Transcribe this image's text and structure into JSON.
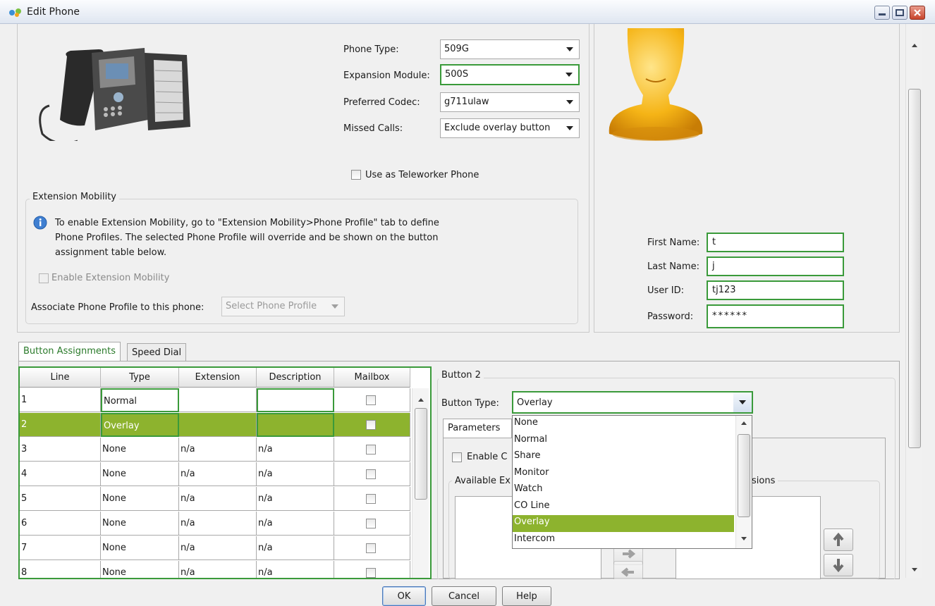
{
  "window": {
    "title": "Edit Phone"
  },
  "phone": {
    "type_label": "Phone Type:",
    "type_value": "509G",
    "module_label": "Expansion Module:",
    "module_value": "500S",
    "codec_label": "Preferred Codec:",
    "codec_value": "g711ulaw",
    "missed_label": "Missed Calls:",
    "missed_value": "Exclude overlay button",
    "teleworker_label": "Use as Teleworker Phone"
  },
  "mobility": {
    "group_label": "Extension Mobility",
    "info_text_1": "To enable Extension Mobility, go to \"Extension Mobility>Phone Profile\" tab to define",
    "info_text_2": "Phone Profiles. The selected Phone Profile will override and be shown on the button",
    "info_text_3": "assignment table below.",
    "enable_label": "Enable Extension Mobility",
    "associate_label": "Associate Phone Profile to this phone:",
    "profile_placeholder": "Select Phone Profile"
  },
  "user": {
    "first_label": "First Name:",
    "first_value": "t",
    "last_label": "Last Name:",
    "last_value": "j",
    "id_label": "User ID:",
    "id_value": "tj123",
    "password_label": "Password:",
    "password_value": "******"
  },
  "tabs": [
    {
      "label": "Button Assignments"
    },
    {
      "label": "Speed Dial"
    }
  ],
  "table": {
    "headers": [
      "Line",
      "Type",
      "Extension",
      "Description",
      "Mailbox"
    ],
    "rows": [
      {
        "line": "1",
        "type": "Normal",
        "extension": "",
        "description": ""
      },
      {
        "line": "2",
        "type": "Overlay",
        "extension": "",
        "description": ""
      },
      {
        "line": "3",
        "type": "None",
        "extension": "n/a",
        "description": "n/a"
      },
      {
        "line": "4",
        "type": "None",
        "extension": "n/a",
        "description": "n/a"
      },
      {
        "line": "5",
        "type": "None",
        "extension": "n/a",
        "description": "n/a"
      },
      {
        "line": "6",
        "type": "None",
        "extension": "n/a",
        "description": "n/a"
      },
      {
        "line": "7",
        "type": "None",
        "extension": "n/a",
        "description": "n/a"
      },
      {
        "line": "8",
        "type": "None",
        "extension": "n/a",
        "description": "n/a"
      }
    ]
  },
  "button_panel": {
    "group_label": "Button 2",
    "type_label": "Button Type:",
    "type_value": "Overlay",
    "params_tab": "Parameters",
    "enable_partial": "Enable C",
    "available_partial": "Available Ex",
    "sions_partial": "sions"
  },
  "dropdown": {
    "options": [
      "None",
      "Normal",
      "Share",
      "Monitor",
      "Watch",
      "CO Line",
      "Overlay",
      "Intercom"
    ],
    "selected": "Overlay"
  },
  "footer": {
    "ok": "OK",
    "cancel": "Cancel",
    "help": "Help"
  },
  "colors": {
    "selection": "#8db32e",
    "focus_border": "#3a9a3a",
    "tab_active_text": "#2a7a2a"
  }
}
